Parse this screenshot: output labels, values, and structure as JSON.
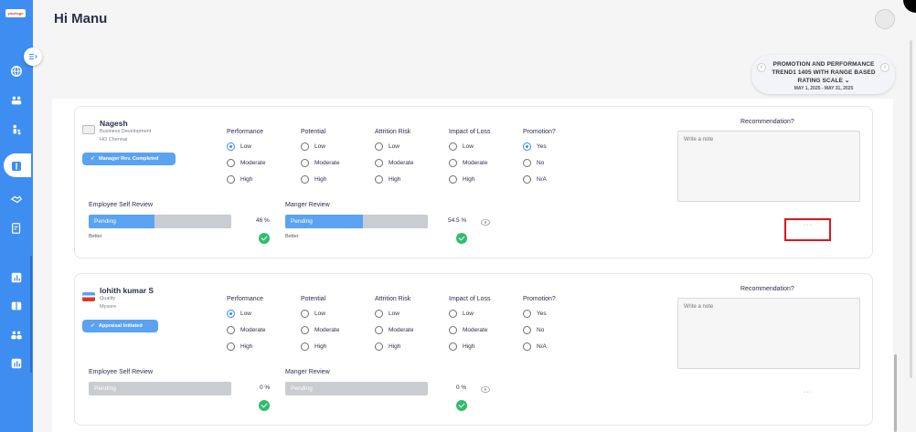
{
  "app": {
    "logo_text": "yourlogo",
    "greeting": "Hi Manu"
  },
  "sidebar": {
    "items": [
      {
        "icon": "globe-icon"
      },
      {
        "icon": "team-icon"
      },
      {
        "icon": "hierarchy-icon"
      },
      {
        "icon": "appraisal-icon",
        "active": true
      },
      {
        "icon": "handshake-icon"
      },
      {
        "icon": "document-edit-icon"
      },
      {
        "icon": "report-chart-icon"
      },
      {
        "icon": "book-icon"
      },
      {
        "icon": "users-group-icon"
      },
      {
        "icon": "analytics-icon"
      }
    ],
    "collapse_icon": "collapse-menu-icon"
  },
  "cycle": {
    "title": "PROMOTION AND PERFORMANCE TREND1 1405 WITH RANGE BASED RATING SCALE",
    "chevron": "⌄",
    "dates": "MAY 1, 2025 - MAY 31, 2025",
    "prev": "‹",
    "next": "›"
  },
  "criteria_headers": [
    "Performance",
    "Potential",
    "Attrition Risk",
    "Impact of Loss",
    "Promotion?"
  ],
  "level_options": [
    "Low",
    "Moderate",
    "High"
  ],
  "promotion_options": [
    "Yes",
    "No",
    "N/A"
  ],
  "labels": {
    "recommendation": "Recommendation?",
    "note_placeholder": "Write a note",
    "self_review": "Employee Self Review",
    "manager_review": "Manger Review",
    "more": "···"
  },
  "employees": [
    {
      "name": "Nagesh",
      "department": "Business Development",
      "location": "HO Chennai",
      "status": "Manager Rev. Completed",
      "self_review": {
        "status": "Pending",
        "percent_text": "46 %",
        "progress": 0.46,
        "rating": "Better"
      },
      "manager_review": {
        "status": "Pending",
        "percent_text": "54.5 %",
        "progress": 0.545,
        "rating": "Better"
      },
      "selections": {
        "Performance": "Low",
        "Potential": "",
        "Attrition Risk": "",
        "Impact of Loss": "",
        "Promotion?": "Yes"
      }
    },
    {
      "name": "lohith kumar S",
      "department": "Quality",
      "location": "Mysore",
      "status": "Appraisal Initiated",
      "self_review": {
        "status": "Pending",
        "percent_text": "0 %",
        "progress": 0,
        "rating": ""
      },
      "manager_review": {
        "status": "Pending",
        "percent_text": "0 %",
        "progress": 0,
        "rating": ""
      },
      "selections": {
        "Performance": "Low",
        "Potential": "",
        "Attrition Risk": "",
        "Impact of Loss": "",
        "Promotion?": ""
      }
    }
  ],
  "colors": {
    "sidebar": "#3d8ef0",
    "status_pill": "#5aa3f2",
    "check": "#2ebd6b",
    "highlight": "#e0161b"
  }
}
